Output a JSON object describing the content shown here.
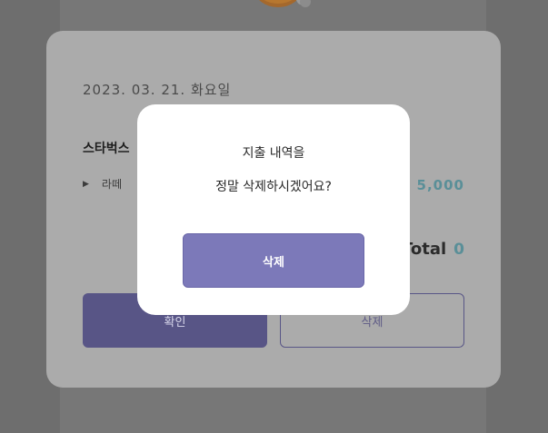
{
  "card": {
    "date": "2023. 03. 21. 화요일",
    "store": "스타벅스",
    "item_name": "라떼",
    "item_price": "5,000",
    "total_label": "Total",
    "total_value": "0",
    "confirm_label": "확인",
    "delete_label": "삭제"
  },
  "modal": {
    "message_line1": "지출 내역을",
    "message_line2": "정말 삭제하시겠어요?",
    "delete_label": "삭제"
  },
  "colors": {
    "accent": "#7c79b9",
    "accent_dark": "#585586",
    "price": "#5a8f98",
    "overlay": "#6e6e6e",
    "card": "#ababab"
  },
  "icons": {
    "item_caret": "caret-right-icon",
    "mascot": "mascot-icon"
  }
}
